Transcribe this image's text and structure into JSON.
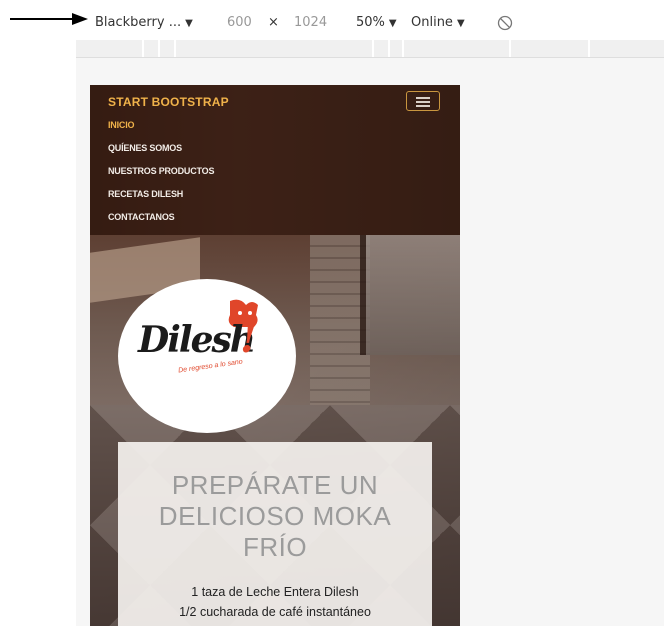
{
  "devtools": {
    "device": "Blackberry ...",
    "width": "600",
    "times": "×",
    "height": "1024",
    "zoom": "50%",
    "throttle": "Online",
    "caret": "▼"
  },
  "site": {
    "brand": "START BOOTSTRAP",
    "nav": [
      "INICIO",
      "QUÍENES SOMOS",
      "NUESTROS PRODUCTOS",
      "RECETAS DILESH",
      "CONTACTANOS"
    ],
    "logo": {
      "wordmark": "Dilesh",
      "bang": "!",
      "tagline": "De regreso a lo sano"
    },
    "card": {
      "title_lines": [
        "PREPÁRATE UN",
        "DELICIOSO MOKA",
        "FRÍO"
      ],
      "ingredients": [
        "1 taza de Leche Entera Dilesh",
        "1/2 cucharada de café instantáneo"
      ]
    }
  },
  "colors": {
    "brand_accent": "#f0b24a",
    "logo_red": "#e0462a"
  }
}
